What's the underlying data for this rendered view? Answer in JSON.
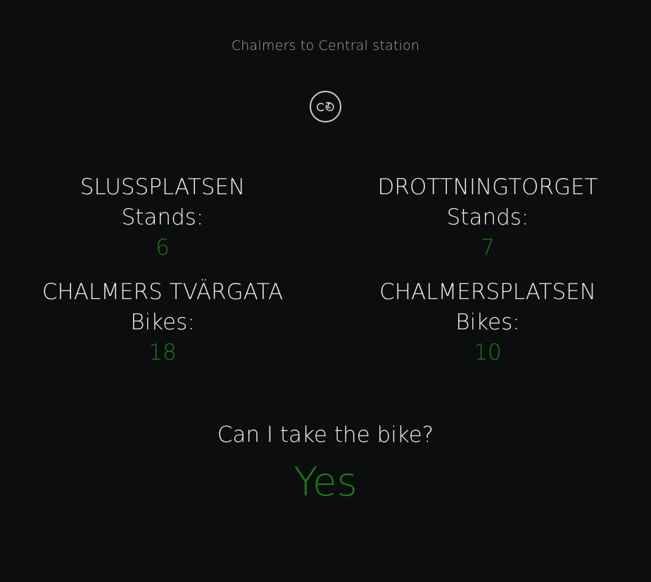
{
  "route": {
    "title": "Chalmers to Central station"
  },
  "toggle": {
    "icon": "bicycle-icon"
  },
  "stations": [
    {
      "name": "SLUSSPLATSEN",
      "kind": "Stands:",
      "count": "6"
    },
    {
      "name": "DROTTNINGTORGET",
      "kind": "Stands:",
      "count": "7"
    },
    {
      "name": "CHALMERS TVÄRGATA",
      "kind": "Bikes:",
      "count": "18"
    },
    {
      "name": "CHALMERSPLATSEN",
      "kind": "Bikes:",
      "count": "10"
    }
  ],
  "verdict": {
    "question": "Can I take the bike?",
    "answer": "Yes"
  },
  "colors": {
    "background": "#0c0d0f",
    "text": "#ececec",
    "muted": "#a8a8a8",
    "positive": "#1e7a1a"
  }
}
